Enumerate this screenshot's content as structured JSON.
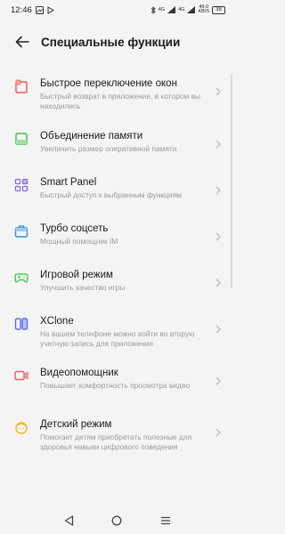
{
  "status_bar": {
    "time": "12:46",
    "network_left": "4G",
    "network_right": "4G",
    "speed": "49,0",
    "speed_unit": "KB/S",
    "battery": "38"
  },
  "header": {
    "title": "Специальные функции"
  },
  "items": [
    {
      "title": "Быстрое переключение окон",
      "subtitle": "Быстрый возврат в приложение, в котором вы находились",
      "icon": "window-switch-icon",
      "color": "#ec5a5a"
    },
    {
      "title": "Объединение памяти",
      "subtitle": "Увеличить размер оперативной памяти",
      "icon": "memory-icon",
      "color": "#3ec24d"
    },
    {
      "title": "Smart Panel",
      "subtitle": "Быстрый доступ к выбранным функциям",
      "icon": "grid-icon",
      "color": "#8a66e0"
    },
    {
      "title": "Турбо соцсеть",
      "subtitle": "Мощный помощник IM",
      "icon": "briefcase-icon",
      "color": "#2f8ce8"
    },
    {
      "title": "Игровой режим",
      "subtitle": "Улучшить качество игры",
      "icon": "gamepad-icon",
      "color": "#3ec24d"
    },
    {
      "title": "XClone",
      "subtitle": "На вашем телефоне можно войти во вторую учетную запись для приложения",
      "icon": "clone-icon",
      "color": "#5a6ce8"
    },
    {
      "title": "Видеопомощник",
      "subtitle": "Повышает комфортность просмотра видео",
      "icon": "video-icon",
      "color": "#ec5a5a"
    },
    {
      "title": "Детский режим",
      "subtitle": "Помогает детям приобретать полезные для здоровья навыки цифрового поведения",
      "icon": "child-icon",
      "color": "#f2b320"
    }
  ],
  "colors": {
    "background": "#f4f4f4",
    "subtitle": "#9a9a9a",
    "chevron": "#bdbdbd"
  }
}
